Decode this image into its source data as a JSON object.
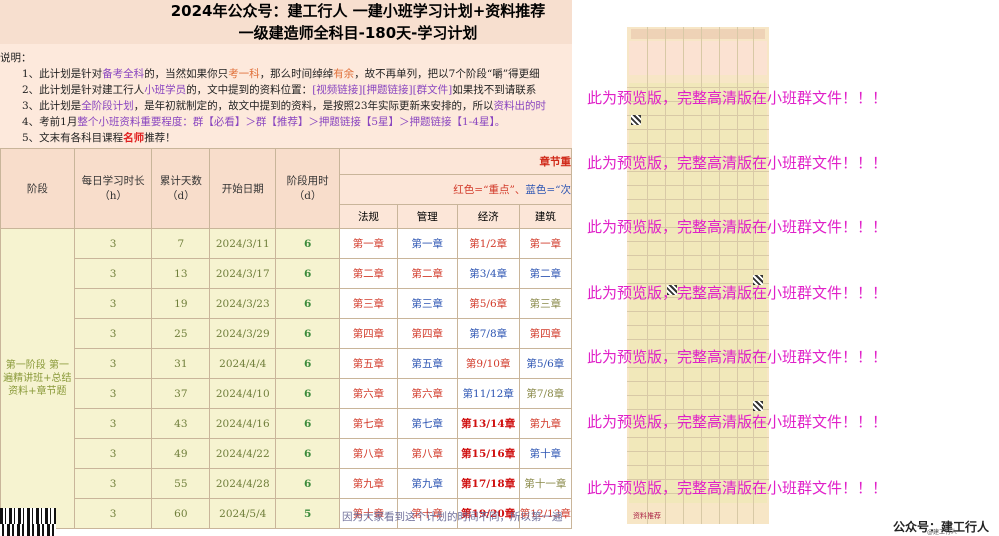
{
  "title_line1": "2024年公众号：建工行人 一建小班学习计划+资料推荐",
  "title_line2": "一级建造师全科目-180天-学习计划",
  "notes": {
    "label": "说明：",
    "l1a": "1、此计划是针对",
    "l1b": "备考全科",
    "l1c": "的，当然如果你只",
    "l1d": "考一科",
    "l1e": "，那么时间绰绰",
    "l1f": "有余",
    "l1g": "，故不再单列，把以7个阶段“嚼”得更细",
    "l2a": "2、此计划是针对建工行人",
    "l2b": "小班学员",
    "l2c": "的，文中提到的资料位置：",
    "l2d": "[视频链接][押题链接][群文件]",
    "l2e": "如果找不到请联系",
    "l3a": "3、此计划是",
    "l3b": "全阶段计划",
    "l3c": "，是年初就制定的，故文中提到的资料，是按照23年实际更新来安排的，所以",
    "l3d": "资料出的时",
    "l4a": "4、考前1月",
    "l4b": "整个小班资料重要程度：",
    "l4c": "群【必看】＞群【推荐】＞押题链接【5星】＞押题链接【1-4星】。",
    "l5a": "5、文末有各科目课程",
    "l5b": "名师",
    "l5c": "推荐！"
  },
  "table": {
    "headers": {
      "phase": "阶段",
      "daily": "每日学习时长（h）",
      "total": "累计天数（d）",
      "start": "开始日期",
      "used": "阶段用时（d）",
      "chapter_title": "章节重",
      "legend_red": "红色=“重点”、",
      "legend_blue": "蓝色=“次",
      "subjects": [
        "法规",
        "管理",
        "经济",
        "建筑"
      ]
    },
    "phase1": "第一阶段 第一遍精讲班+总结资料+章节题",
    "rows": [
      {
        "daily": "3",
        "total": "7",
        "start": "2024/3/11",
        "used": "6",
        "law": "第一章",
        "mgmt": "第一章",
        "econ": "第1/2章",
        "build": "第一章"
      },
      {
        "daily": "3",
        "total": "13",
        "start": "2024/3/17",
        "used": "6",
        "law": "第二章",
        "mgmt": "第二章",
        "econ": "第3/4章",
        "build": "第二章"
      },
      {
        "daily": "3",
        "total": "19",
        "start": "2024/3/23",
        "used": "6",
        "law": "第三章",
        "mgmt": "第三章",
        "econ": "第5/6章",
        "build": "第三章"
      },
      {
        "daily": "3",
        "total": "25",
        "start": "2024/3/29",
        "used": "6",
        "law": "第四章",
        "mgmt": "第四章",
        "econ": "第7/8章",
        "build": "第四章"
      },
      {
        "daily": "3",
        "total": "31",
        "start": "2024/4/4",
        "used": "6",
        "law": "第五章",
        "mgmt": "第五章",
        "econ": "第9/10章",
        "build": "第5/6章"
      },
      {
        "daily": "3",
        "total": "37",
        "start": "2024/4/10",
        "used": "6",
        "law": "第六章",
        "mgmt": "第六章",
        "econ": "第11/12章",
        "build": "第7/8章"
      },
      {
        "daily": "3",
        "total": "43",
        "start": "2024/4/16",
        "used": "6",
        "law": "第七章",
        "mgmt": "第七章",
        "econ": "第13/14章",
        "build": "第九章"
      },
      {
        "daily": "3",
        "total": "49",
        "start": "2024/4/22",
        "used": "6",
        "law": "第八章",
        "mgmt": "第八章",
        "econ": "第15/16章",
        "build": "第十章"
      },
      {
        "daily": "3",
        "total": "55",
        "start": "2024/4/28",
        "used": "6",
        "law": "第九章",
        "mgmt": "第九章",
        "econ": "第17/18章",
        "build": "第十一章"
      },
      {
        "daily": "3",
        "total": "60",
        "start": "2024/5/4",
        "used": "5",
        "law": "第十章",
        "mgmt": "第十章",
        "econ": "第19/20章",
        "build": "第12/13章"
      }
    ],
    "footnote": "因为大家看到这个计划的时间不同，所以第一遍"
  },
  "watermark": "此为预览版，完整高清版在小班群文件！！！",
  "brand": "公众号：建工行人",
  "brand_small": "@建工行人",
  "preview_foot": "资料推荐"
}
